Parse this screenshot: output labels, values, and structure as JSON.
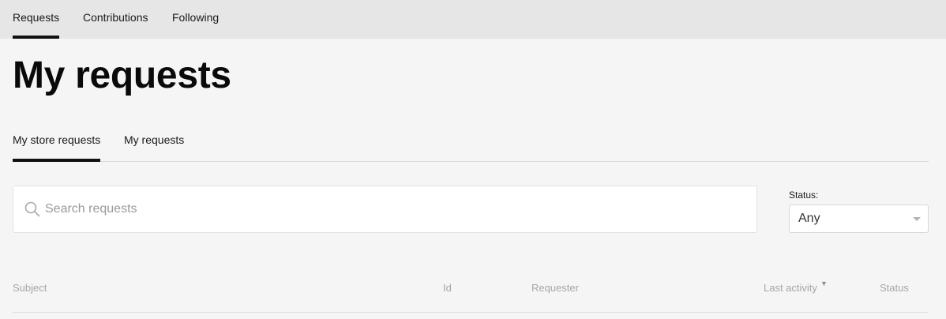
{
  "top_nav": {
    "tabs": [
      {
        "label": "Requests",
        "active": true
      },
      {
        "label": "Contributions",
        "active": false
      },
      {
        "label": "Following",
        "active": false
      }
    ]
  },
  "page": {
    "title": "My requests"
  },
  "sub_tabs": [
    {
      "label": "My store requests",
      "active": true
    },
    {
      "label": "My requests",
      "active": false
    }
  ],
  "search": {
    "placeholder": "Search requests",
    "value": ""
  },
  "status_filter": {
    "label": "Status:",
    "selected": "Any"
  },
  "table": {
    "columns": [
      {
        "label": "Subject"
      },
      {
        "label": "Id"
      },
      {
        "label": "Requester"
      },
      {
        "label": "Last activity",
        "sorted": "desc"
      },
      {
        "label": "Status"
      }
    ],
    "rows": []
  },
  "colors": {
    "top_nav_bg": "#e6e6e6",
    "page_bg": "#f5f5f5",
    "active_indicator": "#111111",
    "muted_text": "#a6a6a6"
  }
}
